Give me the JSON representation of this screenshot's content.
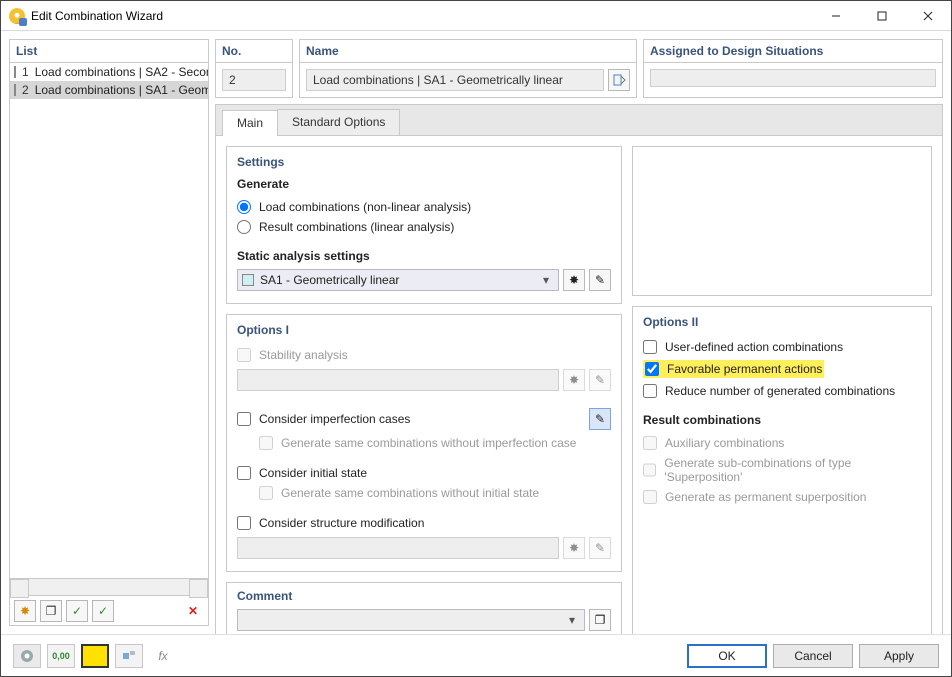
{
  "window": {
    "title": "Edit Combination Wizard"
  },
  "list": {
    "header": "List",
    "items": [
      {
        "num": "1",
        "label": "Load combinations | SA2 - Secon",
        "color": "#cfeff0",
        "selected": false
      },
      {
        "num": "2",
        "label": "Load combinations | SA1 - Geom",
        "color": "#c6a600",
        "selected": true
      }
    ]
  },
  "top": {
    "no_label": "No.",
    "no_value": "2",
    "name_label": "Name",
    "name_value": "Load combinations | SA1 - Geometrically linear",
    "assigned_label": "Assigned to Design Situations",
    "assigned_value": ""
  },
  "tabs": {
    "main": "Main",
    "std": "Standard Options"
  },
  "settings": {
    "title": "Settings",
    "generate_label": "Generate",
    "r1": "Load combinations (non-linear analysis)",
    "r2": "Result combinations (linear analysis)",
    "static_label": "Static analysis settings",
    "static_value": "SA1 - Geometrically linear"
  },
  "options1": {
    "title": "Options I",
    "stability": "Stability analysis",
    "imp": "Consider imperfection cases",
    "imp_sub": "Generate same combinations without imperfection case",
    "initial": "Consider initial state",
    "initial_sub": "Generate same combinations without initial state",
    "struct": "Consider structure modification"
  },
  "options2": {
    "title": "Options II",
    "u1": "User-defined action combinations",
    "u2": "Favorable permanent actions",
    "u3": "Reduce number of generated combinations",
    "rc_title": "Result combinations",
    "rc1": "Auxiliary combinations",
    "rc2": "Generate sub-combinations of type 'Superposition'",
    "rc3": "Generate as permanent superposition"
  },
  "comment": {
    "title": "Comment",
    "value": ""
  },
  "buttons": {
    "ok": "OK",
    "cancel": "Cancel",
    "apply": "Apply"
  }
}
